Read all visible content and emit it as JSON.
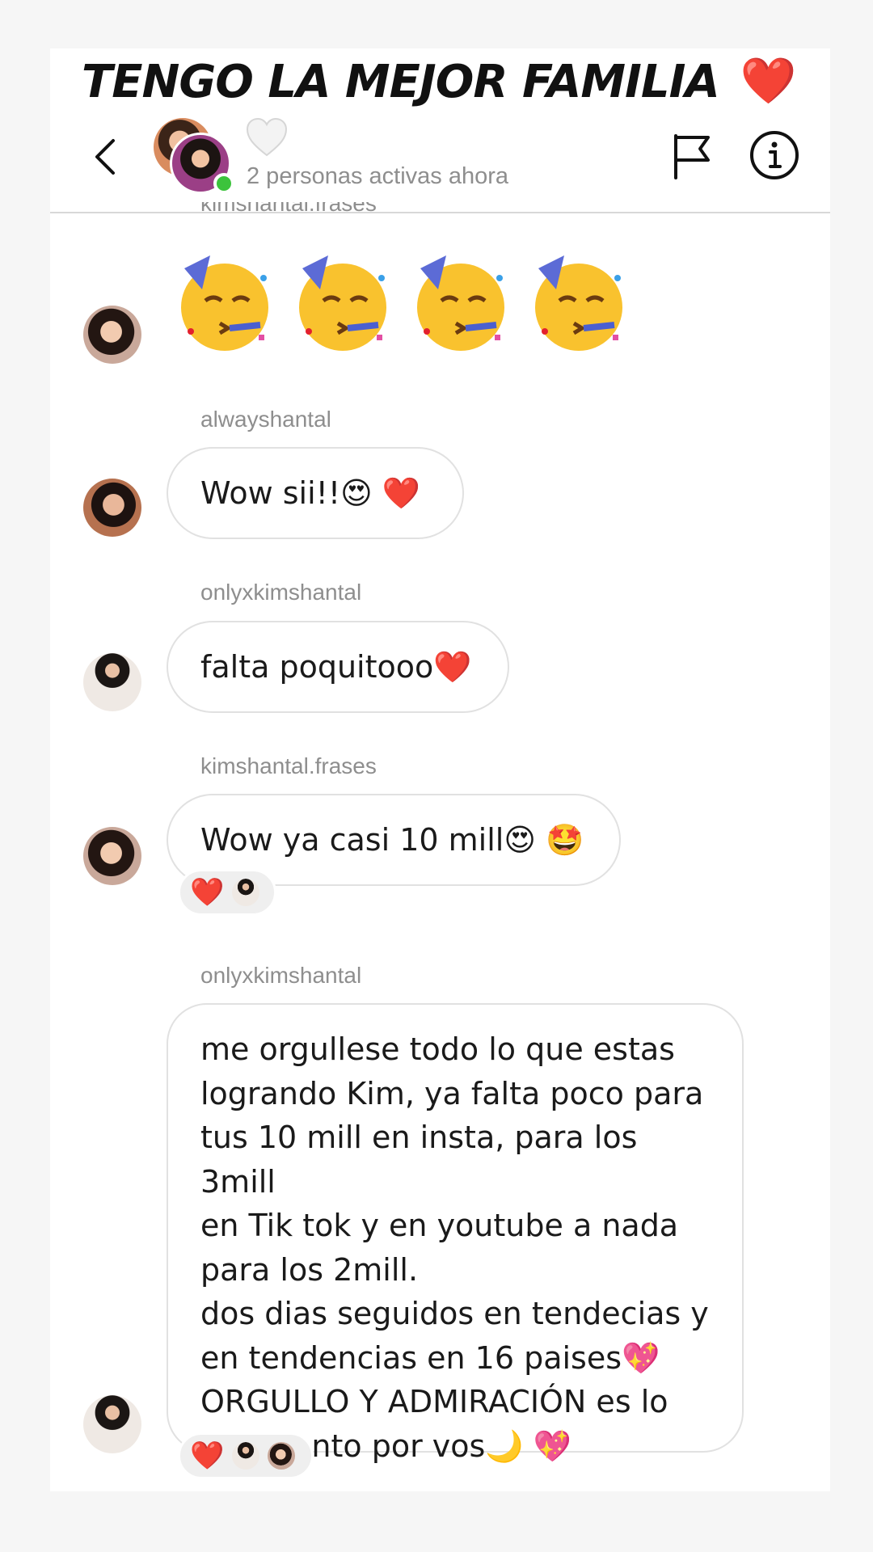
{
  "banner": {
    "title": "TENGO LA MEJOR FAMILIA",
    "heart": "❤️"
  },
  "header": {
    "back_icon": "chevron-left-icon",
    "chat_icon": "white-heart-icon",
    "active_status": "2 personas activas ahora",
    "flag_icon": "flag-icon",
    "info_icon": "info-icon",
    "online_color": "#3cc33c"
  },
  "messages": [
    {
      "sender": "kimshantal.frases",
      "type": "emoji",
      "content": "🥳🥳🥳🥳"
    },
    {
      "sender": "alwayshantal",
      "type": "text",
      "content": "Wow sii!!😍 ❤️"
    },
    {
      "sender": "onlyxkimshantal",
      "type": "text",
      "content": "falta poquitooo❤️"
    },
    {
      "sender": "kimshantal.frases",
      "type": "text",
      "content": "Wow ya casi 10 mill😍 🤩",
      "reactions": [
        "❤️"
      ]
    },
    {
      "sender": "onlyxkimshantal",
      "type": "text",
      "content_lines": [
        "me orgullese todo lo que estas",
        "logrando Kim, ya falta poco para",
        "tus 10 mill en insta, para los 3mill",
        "en Tik tok y en youtube a nada",
        "para los 2mill.",
        "dos dias seguidos en tendecias y",
        "en tendencias en 16 paises💖",
        "ORGULLO Y ADMIRACIÓN es lo",
        "que siento por vos🌙 💖"
      ],
      "reactions": [
        "❤️"
      ]
    }
  ],
  "colors": {
    "heart_red": "#e3202e",
    "muted_text": "#8e8e8e",
    "bubble_border": "#e1e1e1"
  }
}
